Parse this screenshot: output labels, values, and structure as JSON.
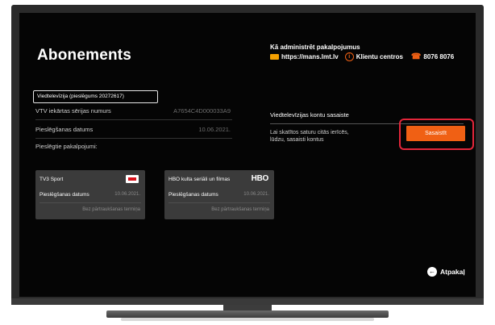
{
  "page": {
    "title": "Abonements"
  },
  "admin": {
    "title": "Kā administrēt pakalpojumus",
    "url": "https://mans.lmt.lv",
    "centers": "Klientu centros",
    "phone": "8076 8076",
    "icons": [
      "monitor-icon",
      "info-icon",
      "phone-icon"
    ]
  },
  "subscription": {
    "chip": "Viedtelevīzija (pieslēgums 20272617)",
    "rows": [
      {
        "label": "VTV iekārtas sērijas numurs",
        "value": "A7654C4D000033A9"
      },
      {
        "label": "Pieslēgšanas datums",
        "value": "10.06.2021."
      }
    ],
    "included_label": "Pieslēgtie pakalpojumi:"
  },
  "cards": [
    {
      "name": "TV3 Sport",
      "logo": "tv3-logo",
      "detail_label": "Pieslēgšanas datums",
      "detail_value": "10.06.2021.",
      "term": "Bez pārtraukšanas termiņa"
    },
    {
      "name": "HBO kulta seriāli un filmas",
      "logo": "HBO",
      "detail_label": "Pieslēgšanas datums",
      "detail_value": "10.06.2021.",
      "term": "Bez pārtraukšanas termiņa"
    }
  ],
  "linking": {
    "heading": "Viedtelevīzijas kontu sasaiste",
    "description": "Lai skatītos saturu citās ierīcēs, lūdzu, sasaisti kontus",
    "button": "Sasaistīt",
    "accent": "#f06014",
    "highlight": "#e3263a"
  },
  "back": {
    "label": "Atpakaļ",
    "icon": "back-arrow-icon"
  }
}
